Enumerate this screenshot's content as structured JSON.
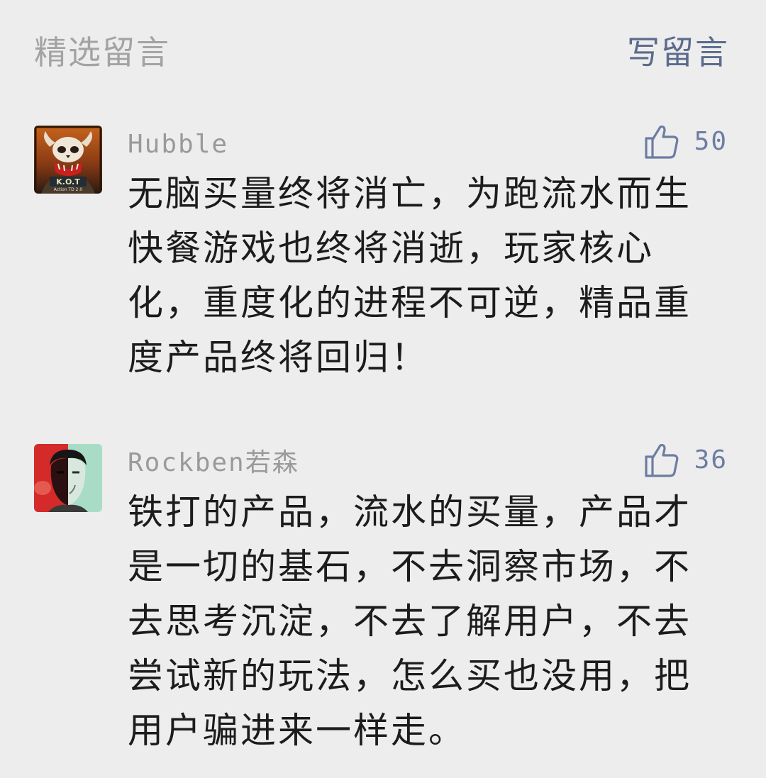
{
  "header": {
    "title": "精选留言",
    "write_label": "写留言"
  },
  "comments": [
    {
      "author": "Hubble",
      "avatar_text": "K.O.T",
      "avatar_subtext": "Action TD 2.0",
      "likes": "50",
      "text": "无脑买量终将消亡，为跑流水而生快餐游戏也终将消逝，玩家核心化，重度化的进程不可逆，精品重度产品终将回归！"
    },
    {
      "author": "Rockben若森",
      "likes": "36",
      "text": "铁打的产品，流水的买量，产品才是一切的基石，不去洞察市场，不去思考沉淀，不去了解用户，不去尝试新的玩法，怎么买也没用，把用户骗进来一样走。"
    }
  ],
  "colors": {
    "background": "#ededed",
    "link": "#5b6b8c",
    "muted": "#a3a3a3",
    "text": "#1c1c1c"
  },
  "icons": {
    "like": "thumbs-up-icon",
    "avatar_1": "orc-skull-avatar",
    "avatar_2": "split-face-avatar"
  }
}
